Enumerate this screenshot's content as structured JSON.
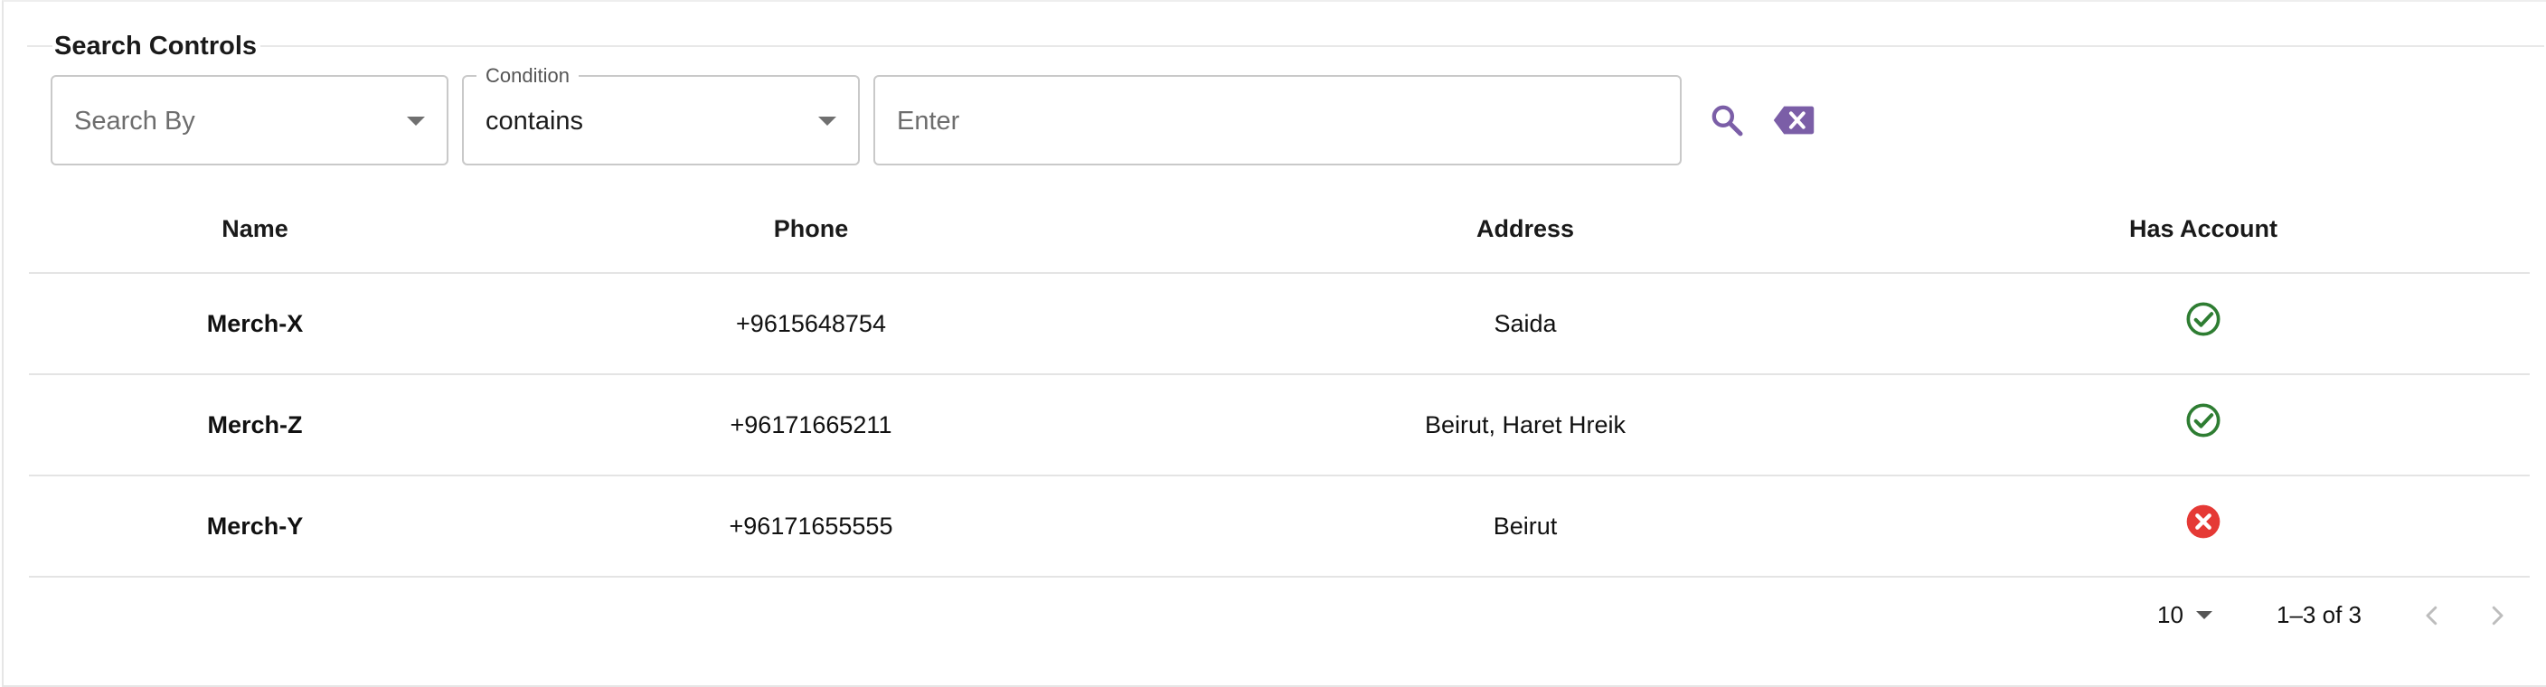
{
  "search": {
    "group_title": "Search Controls",
    "search_by_placeholder": "Search By",
    "condition_label": "Condition",
    "condition_value": "contains",
    "query_placeholder": "Enter"
  },
  "table": {
    "columns": [
      "Name",
      "Phone",
      "Address",
      "Has Account"
    ],
    "rows": [
      {
        "name": "Merch-X",
        "phone": "+9615648754",
        "address": "Saida",
        "has_account": true
      },
      {
        "name": "Merch-Z",
        "phone": "+96171665211",
        "address": "Beirut, Haret Hreik",
        "has_account": true
      },
      {
        "name": "Merch-Y",
        "phone": "+96171655555",
        "address": "Beirut",
        "has_account": false
      }
    ]
  },
  "pagination": {
    "rows_per_page": "10",
    "range": "1–3 of 3"
  },
  "colors": {
    "accent": "#7b5ea7",
    "success": "#2e7d32",
    "error": "#e53935"
  },
  "icons": {
    "search": "search-icon",
    "clear": "backspace-clear-icon",
    "has_account_yes": "check-circle-icon",
    "has_account_no": "cancel-circle-icon",
    "prev": "chevron-left-icon",
    "next": "chevron-right-icon"
  }
}
